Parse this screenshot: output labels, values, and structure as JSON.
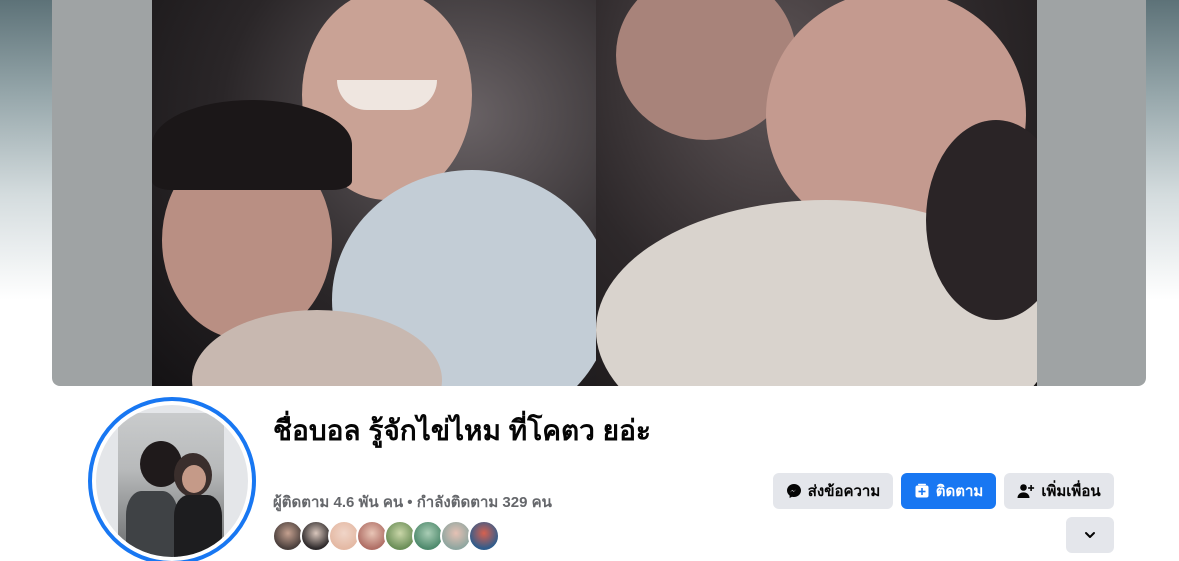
{
  "profile": {
    "name": "ชื่อบอล รู้จักไข่ไหม ที่โคตว ยอ่ะ",
    "stats": "ผู้ติดตาม 4.6 พัน คน • กำลังติดตาม 329 คน"
  },
  "actions": {
    "message_label": "ส่งข้อความ",
    "follow_label": "ติดตาม",
    "add_friend_label": "เพิ่มเพื่อน"
  },
  "colors": {
    "accent": "#1877f2",
    "button_gray": "#e4e6eb",
    "text_primary": "#050505",
    "text_secondary": "#65676b"
  },
  "icons": {
    "message": "messenger-icon",
    "follow": "follow-plus-icon",
    "add_friend": "person-add-icon",
    "more": "chevron-down-icon"
  }
}
